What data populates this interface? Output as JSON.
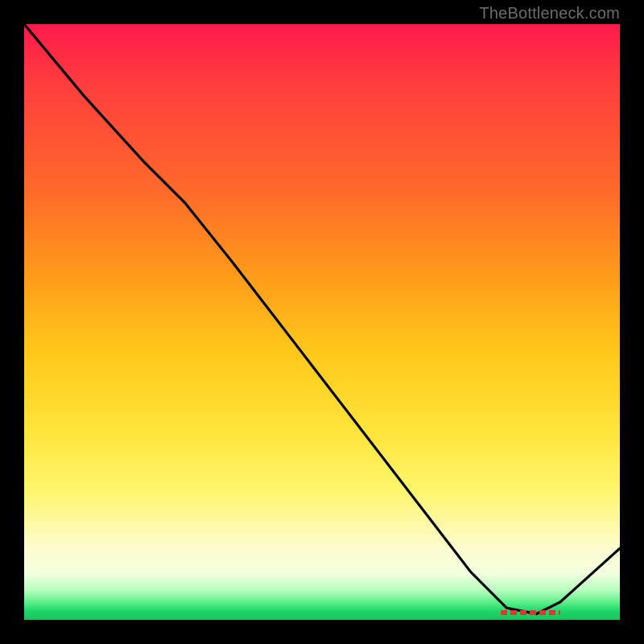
{
  "attribution": "TheBottleneck.com",
  "chart_data": {
    "type": "line",
    "title": "",
    "xlabel": "",
    "ylabel": "",
    "xlim": [
      0,
      100
    ],
    "ylim": [
      0,
      100
    ],
    "series": [
      {
        "name": "bottleneck-curve",
        "x": [
          0,
          10,
          20,
          27,
          35,
          45,
          55,
          65,
          75,
          81,
          86,
          90,
          100
        ],
        "y": [
          100,
          88,
          77,
          70,
          60,
          47,
          34,
          21,
          8,
          2,
          1,
          3,
          12
        ]
      }
    ],
    "marker": {
      "name": "optimal-range",
      "x_start": 80,
      "x_end": 90,
      "y": 1.2
    },
    "gradient_stops": [
      {
        "pos": 0,
        "color": "#ff1a4d"
      },
      {
        "pos": 0.42,
        "color": "#ff9a1a"
      },
      {
        "pos": 0.78,
        "color": "#fff56a"
      },
      {
        "pos": 0.97,
        "color": "#5fef8a"
      },
      {
        "pos": 1.0,
        "color": "#17c45f"
      }
    ]
  }
}
